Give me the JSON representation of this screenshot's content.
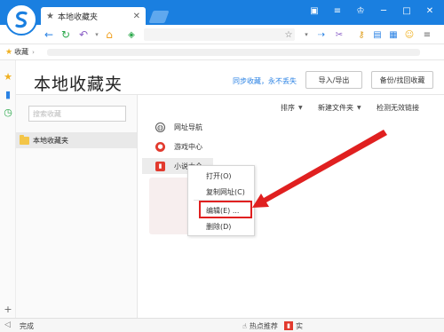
{
  "tab": {
    "title": "本地收藏夹"
  },
  "favbar": {
    "label": "收藏"
  },
  "page": {
    "title": "本地收藏夹",
    "sync_text": "同步收藏，永不丢失",
    "import_export": "导入/导出",
    "backup_restore": "备份/找回收藏"
  },
  "tree": {
    "search_placeholder": "搜索收藏",
    "folder_label": "本地收藏夹"
  },
  "list_toolbar": {
    "sort": "排序",
    "new_folder": "新建文件夹",
    "check_invalid": "检测无效链接"
  },
  "bookmarks": [
    {
      "label": "网址导航"
    },
    {
      "label": "游戏中心"
    },
    {
      "label": "小说大全"
    }
  ],
  "context_menu": {
    "items": [
      "打开(O)",
      "复制网址(C)",
      "编辑(E) ...",
      "删除(D)"
    ]
  },
  "statusbar": {
    "done": "完成",
    "hot": "热点推荐",
    "right": "实"
  },
  "colors": {
    "brand": "#1a7fe0",
    "accent_red": "#e02020",
    "link_blue": "#2a82e4"
  }
}
